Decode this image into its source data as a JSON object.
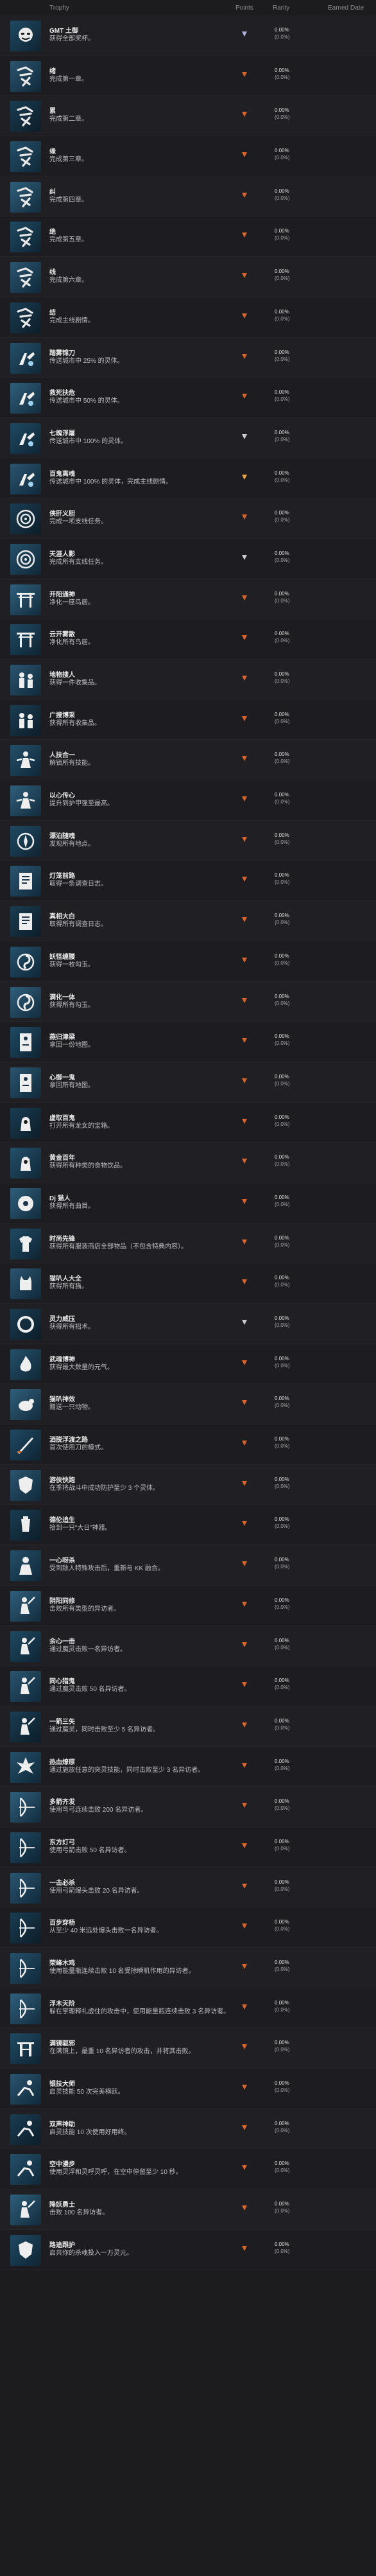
{
  "header": {
    "trophy": "Trophy",
    "points": "Points",
    "rarity": "Rarity",
    "earned": "Earned Date"
  },
  "colors": {
    "platinum": "#aab2d8",
    "gold": "#e6a23c",
    "bronze": "#d8642c",
    "silver": "#c6c9cf"
  },
  "trophies": [
    {
      "name": "GMT 土御",
      "desc": "获得全部奖杯。",
      "grade": "platinum",
      "rarity_a": "0.00%",
      "rarity_b": "(0.0%)",
      "icon": "oni-mask-icon"
    },
    {
      "name": "绪",
      "desc": "完成第一章。",
      "grade": "bronze",
      "rarity_a": "0.00%",
      "rarity_b": "(0.0%)",
      "icon": "calligraphy-chapter-icon"
    },
    {
      "name": "累",
      "desc": "完成第二章。",
      "grade": "bronze",
      "rarity_a": "0.00%",
      "rarity_b": "(0.0%)",
      "icon": "calligraphy-chapter-icon"
    },
    {
      "name": "缘",
      "desc": "完成第三章。",
      "grade": "bronze",
      "rarity_a": "0.00%",
      "rarity_b": "(0.0%)",
      "icon": "calligraphy-chapter-icon"
    },
    {
      "name": "纠",
      "desc": "完成第四章。",
      "grade": "bronze",
      "rarity_a": "0.00%",
      "rarity_b": "(0.0%)",
      "icon": "calligraphy-chapter-icon"
    },
    {
      "name": "绝",
      "desc": "完成第五章。",
      "grade": "bronze",
      "rarity_a": "0.00%",
      "rarity_b": "(0.0%)",
      "icon": "calligraphy-chapter-icon"
    },
    {
      "name": "线",
      "desc": "完成第六章。",
      "grade": "bronze",
      "rarity_a": "0.00%",
      "rarity_b": "(0.0%)",
      "icon": "calligraphy-chapter-icon"
    },
    {
      "name": "结",
      "desc": "完成主线剧情。",
      "grade": "bronze",
      "rarity_a": "0.00%",
      "rarity_b": "(0.0%)",
      "icon": "calligraphy-chapter-icon"
    },
    {
      "name": "踏雾锦刀",
      "desc": "传送城市中 25% 的灵体。",
      "grade": "bronze",
      "rarity_a": "0.00%",
      "rarity_b": "(0.0%)",
      "icon": "spirit-hand-icon"
    },
    {
      "name": "救死扶危",
      "desc": "传送城市中 50% 的灵体。",
      "grade": "bronze",
      "rarity_a": "0.00%",
      "rarity_b": "(0.0%)",
      "icon": "spirit-hand-icon"
    },
    {
      "name": "七魄浮屠",
      "desc": "传送城市中 100% 的灵体。",
      "grade": "silver",
      "rarity_a": "0.00%",
      "rarity_b": "(0.0%)",
      "icon": "spirit-hand-icon"
    },
    {
      "name": "百鬼离魂",
      "desc": "传送城市中 100% 的灵体，完成主线剧情。",
      "grade": "gold",
      "rarity_a": "0.00%",
      "rarity_b": "(0.0%)",
      "icon": "spirit-hand-icon"
    },
    {
      "name": "侠肝义胆",
      "desc": "完成一项支线任务。",
      "grade": "bronze",
      "rarity_a": "0.00%",
      "rarity_b": "(0.0%)",
      "icon": "spiral-icon"
    },
    {
      "name": "天涯人影",
      "desc": "完成所有支线任务。",
      "grade": "silver",
      "rarity_a": "0.00%",
      "rarity_b": "(0.0%)",
      "icon": "spiral-icon"
    },
    {
      "name": "开阳通神",
      "desc": "净化一座鸟居。",
      "grade": "bronze",
      "rarity_a": "0.00%",
      "rarity_b": "(0.0%)",
      "icon": "torii-gate-icon"
    },
    {
      "name": "云开雾散",
      "desc": "净化所有鸟居。",
      "grade": "bronze",
      "rarity_a": "0.00%",
      "rarity_b": "(0.0%)",
      "icon": "torii-gate-icon"
    },
    {
      "name": "地物搜人",
      "desc": "获得一件收集品。",
      "grade": "bronze",
      "rarity_a": "0.00%",
      "rarity_b": "(0.0%)",
      "icon": "figure-pair-icon"
    },
    {
      "name": "广搜博采",
      "desc": "获得所有收集品。",
      "grade": "bronze",
      "rarity_a": "0.00%",
      "rarity_b": "(0.0%)",
      "icon": "figure-pair-icon"
    },
    {
      "name": "人技合一",
      "desc": "解锁所有技能。",
      "grade": "bronze",
      "rarity_a": "0.00%",
      "rarity_b": "(0.0%)",
      "icon": "skill-figure-icon"
    },
    {
      "name": "以心传心",
      "desc": "提升到护甲强至最高。",
      "grade": "bronze",
      "rarity_a": "0.00%",
      "rarity_b": "(0.0%)",
      "icon": "skill-figure-icon"
    },
    {
      "name": "漂泊随魂",
      "desc": "发现所有地点。",
      "grade": "bronze",
      "rarity_a": "0.00%",
      "rarity_b": "(0.0%)",
      "icon": "compass-icon"
    },
    {
      "name": "灯笼前路",
      "desc": "取得一条调查日志。",
      "grade": "bronze",
      "rarity_a": "0.00%",
      "rarity_b": "(0.0%)",
      "icon": "journal-icon"
    },
    {
      "name": "真相大白",
      "desc": "取得所有调查日志。",
      "grade": "bronze",
      "rarity_a": "0.00%",
      "rarity_b": "(0.0%)",
      "icon": "journal-icon"
    },
    {
      "name": "妖怪缠腰",
      "desc": "获得一枚勾玉。",
      "grade": "bronze",
      "rarity_a": "0.00%",
      "rarity_b": "(0.0%)",
      "icon": "magatama-icon"
    },
    {
      "name": "满化一体",
      "desc": "获得所有勾玉。",
      "grade": "bronze",
      "rarity_a": "0.00%",
      "rarity_b": "(0.0%)",
      "icon": "magatama-icon"
    },
    {
      "name": "燕归津梁",
      "desc": "拿回一份地图。",
      "grade": "bronze",
      "rarity_a": "0.00%",
      "rarity_b": "(0.0%)",
      "icon": "scroll-map-icon"
    },
    {
      "name": "心御一鬼",
      "desc": "拿回所有地图。",
      "grade": "bronze",
      "rarity_a": "0.00%",
      "rarity_b": "(0.0%)",
      "icon": "scroll-map-icon"
    },
    {
      "name": "虚取百鬼",
      "desc": "打开所有龙女的宝箱。",
      "grade": "bronze",
      "rarity_a": "0.00%",
      "rarity_b": "(0.0%)",
      "icon": "hooded-figure-icon"
    },
    {
      "name": "黄金百年",
      "desc": "获得所有种类的食物饮品。",
      "grade": "bronze",
      "rarity_a": "0.00%",
      "rarity_b": "(0.0%)",
      "icon": "hooded-figure-icon"
    },
    {
      "name": "Dj 猫人",
      "desc": "获得所有曲目。",
      "grade": "bronze",
      "rarity_a": "0.00%",
      "rarity_b": "(0.0%)",
      "icon": "disc-icon"
    },
    {
      "name": "时尚先锋",
      "desc": "获得所有服装商店全部物品（不包含特典内容）。",
      "grade": "bronze",
      "rarity_a": "0.00%",
      "rarity_b": "(0.0%)",
      "icon": "shirt-icon"
    },
    {
      "name": "猫叭人大全",
      "desc": "获得所有猫。",
      "grade": "bronze",
      "rarity_a": "0.00%",
      "rarity_b": "(0.0%)",
      "icon": "cat-icon"
    },
    {
      "name": "灵力威压",
      "desc": "获得所有招术。",
      "grade": "silver",
      "rarity_a": "0.00%",
      "rarity_b": "(0.0%)",
      "icon": "ring-icon"
    },
    {
      "name": "武魂博神",
      "desc": "获得最大数量的元气。",
      "grade": "bronze",
      "rarity_a": "0.00%",
      "rarity_b": "(0.0%)",
      "icon": "fire-figure-icon"
    },
    {
      "name": "猫叭神效",
      "desc": "赠送一只动物。",
      "grade": "bronze",
      "rarity_a": "0.00%",
      "rarity_b": "(0.0%)",
      "icon": "creature-icon"
    },
    {
      "name": "洒脱浮渡之路",
      "desc": "首次使用刀的模式。",
      "grade": "bronze",
      "rarity_a": "0.00%",
      "rarity_b": "(0.0%)",
      "icon": "blade-icon"
    },
    {
      "name": "游侠快跑",
      "desc": "在季将战斗中成功防护至少 3 个灵体。",
      "grade": "bronze",
      "rarity_a": "0.00%",
      "rarity_b": "(0.0%)",
      "icon": "shield-figure-icon"
    },
    {
      "name": "德伦追生",
      "desc": "拾到一只“大日”神器。",
      "grade": "bronze",
      "rarity_a": "0.00%",
      "rarity_b": "(0.0%)",
      "icon": "vessel-icon"
    },
    {
      "name": "一心呀杀",
      "desc": "受到敌人特殊攻击后，重新与 KK 融合。",
      "grade": "bronze",
      "rarity_a": "0.00%",
      "rarity_b": "(0.0%)",
      "icon": "silhouette-icon"
    },
    {
      "name": "阴阳同修",
      "desc": "击败所有类型的异访者。",
      "grade": "bronze",
      "rarity_a": "0.00%",
      "rarity_b": "(0.0%)",
      "icon": "warrior-icon"
    },
    {
      "name": "余心一击",
      "desc": "通过魔灵击败一名异访者。",
      "grade": "bronze",
      "rarity_a": "0.00%",
      "rarity_b": "(0.0%)",
      "icon": "warrior-icon"
    },
    {
      "name": "同心猎鬼",
      "desc": "通过魔灵击败 50 名异访者。",
      "grade": "bronze",
      "rarity_a": "0.00%",
      "rarity_b": "(0.0%)",
      "icon": "warrior-icon"
    },
    {
      "name": "一箭三矢",
      "desc": "通过魔灵，同时击败至少 5 名异访者。",
      "grade": "bronze",
      "rarity_a": "0.00%",
      "rarity_b": "(0.0%)",
      "icon": "warrior-icon"
    },
    {
      "name": "热血燎原",
      "desc": "通过施放任意的突灵技能，同时击败至少 3 名异访者。",
      "grade": "bronze",
      "rarity_a": "0.00%",
      "rarity_b": "(0.0%)",
      "icon": "flame-burst-icon"
    },
    {
      "name": "多箭齐发",
      "desc": "使用弯弓连续击败 200 名异访者。",
      "grade": "bronze",
      "rarity_a": "0.00%",
      "rarity_b": "(0.0%)",
      "icon": "bow-icon"
    },
    {
      "name": "东方灯弓",
      "desc": "使用弓箭击败 50 名异访者。",
      "grade": "bronze",
      "rarity_a": "0.00%",
      "rarity_b": "(0.0%)",
      "icon": "bow-icon"
    },
    {
      "name": "一击必杀",
      "desc": "使用弓箭爆头击败 20 名异访者。",
      "grade": "bronze",
      "rarity_a": "0.00%",
      "rarity_b": "(0.0%)",
      "icon": "bow-icon"
    },
    {
      "name": "百步穿杨",
      "desc": "从至少 40 米远处爆头击败一名异访者。",
      "grade": "bronze",
      "rarity_a": "0.00%",
      "rarity_b": "(0.0%)",
      "icon": "bow-icon"
    },
    {
      "name": "荣峰木鸡",
      "desc": "使用能量瓶连续击败 10 名受掠瞬机作用的异访者。",
      "grade": "bronze",
      "rarity_a": "0.00%",
      "rarity_b": "(0.0%)",
      "icon": "bow-icon"
    },
    {
      "name": "浮木天阶",
      "desc": "躲在掌理释礼虚住的攻击中，使用能量瓶连续击败 3 名异访者。",
      "grade": "bronze",
      "rarity_a": "0.00%",
      "rarity_b": "(0.0%)",
      "icon": "bow-icon"
    },
    {
      "name": "满镜驱邪",
      "desc": "在满镜上，最重 10 名异访者的攻击，并将其击败。",
      "grade": "bronze",
      "rarity_a": "0.00%",
      "rarity_b": "(0.0%)",
      "icon": "gate-shrine-icon"
    },
    {
      "name": "银技大师",
      "desc": "启灵技能 50 次完美横跃。",
      "grade": "bronze",
      "rarity_a": "0.00%",
      "rarity_b": "(0.0%)",
      "icon": "leap-icon"
    },
    {
      "name": "双声神助",
      "desc": "启灵技能 10 次使用好用终。",
      "grade": "bronze",
      "rarity_a": "0.00%",
      "rarity_b": "(0.0%)",
      "icon": "leap-icon"
    },
    {
      "name": "空中漫步",
      "desc": "使用灵浮和灵呼灵呼，在空中停留至少 10 秒。",
      "grade": "bronze",
      "rarity_a": "0.00%",
      "rarity_b": "(0.0%)",
      "icon": "leap-icon"
    },
    {
      "name": "降妖勇士",
      "desc": "击败 100 名异访者。",
      "grade": "bronze",
      "rarity_a": "0.00%",
      "rarity_b": "(0.0%)",
      "icon": "warrior-icon"
    },
    {
      "name": "路途跟护",
      "desc": "启共你的杀魂投入一万灵元。",
      "grade": "bronze",
      "rarity_a": "0.00%",
      "rarity_b": "(0.0%)",
      "icon": "shield-figure-icon"
    }
  ]
}
